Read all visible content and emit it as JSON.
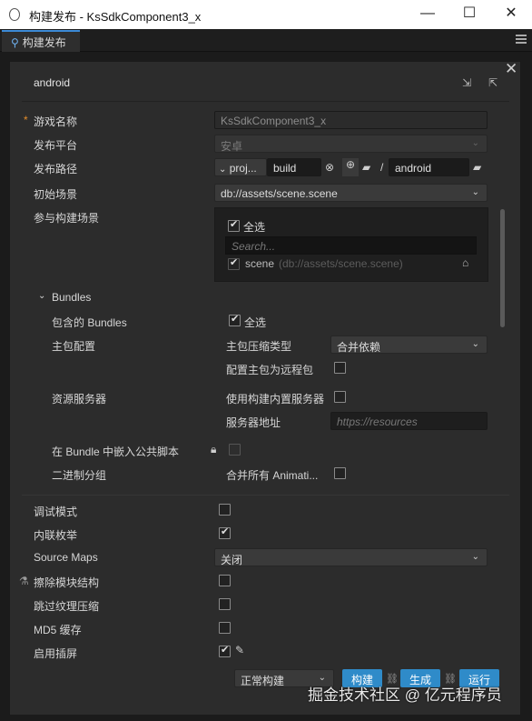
{
  "window": {
    "title": "构建发布 - KsSdkComponent3_x",
    "controls": {
      "minimize": "—",
      "maximize": "☐",
      "close": "✕"
    }
  },
  "tab": {
    "label": "构建发布",
    "icon": "build-publish-icon"
  },
  "header": {
    "platform": "android",
    "close": "✕"
  },
  "fields": {
    "game_name": {
      "label": "游戏名称",
      "required_mark": "*",
      "value": "KsSdkComponent3_x"
    },
    "platform": {
      "label": "发布平台",
      "value": "安卓"
    },
    "build_path": {
      "label": "发布路径",
      "prefix": "proj...",
      "folder": "build",
      "slash": "/",
      "sub": "android"
    },
    "start_scene": {
      "label": "初始场景",
      "value": "db://assets/scene.scene"
    },
    "scenes": {
      "label": "参与构建场景",
      "select_all": "全选",
      "search_placeholder": "Search...",
      "item_name": "scene",
      "item_path": "(db://assets/scene.scene)"
    }
  },
  "bundles": {
    "section": "Bundles",
    "included_label": "包含的 Bundles",
    "included_select_all": "全选",
    "main_config_label": "主包配置",
    "compress_type_label": "主包压缩类型",
    "compress_type_value": "合并依赖",
    "remote_main_label": "配置主包为远程包",
    "resource_server_label": "资源服务器",
    "builtin_server_label": "使用构建内置服务器",
    "server_address_label": "服务器地址",
    "server_address_placeholder": "https://resources",
    "embed_scripts_label": "在 Bundle 中嵌入公共脚本",
    "binary_group_label": "二进制分组",
    "merge_anim_label": "合并所有 Animati..."
  },
  "options": {
    "debug": "调试模式",
    "inline_enum": "内联枚举",
    "source_maps": "Source Maps",
    "source_maps_value": "关闭",
    "erase_modules": "擦除模块结构",
    "skip_texture": "跳过纹理压缩",
    "md5_cache": "MD5 缓存",
    "splash": "启用插屏"
  },
  "footer": {
    "build_mode": "正常构建",
    "build": "构建",
    "make": "生成",
    "run": "运行"
  },
  "watermark": "掘金技术社区 @ 亿元程序员",
  "colors": {
    "accent": "#2f8bc9",
    "required": "#e38d2c",
    "tab_highlight": "#3c8ad6"
  }
}
